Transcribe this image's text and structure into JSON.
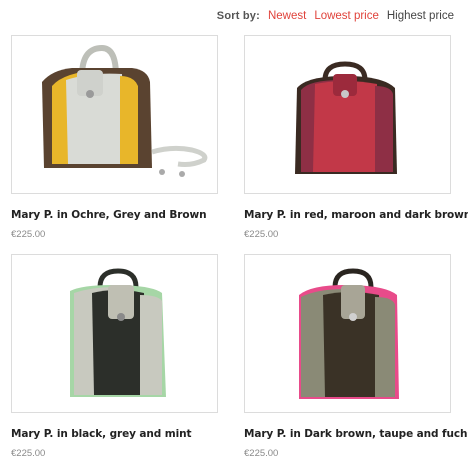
{
  "sort": {
    "label": "Sort by:",
    "options": [
      "Newest",
      "Lowest price",
      "Highest price"
    ]
  },
  "products": [
    {
      "title": "Mary P. in Ochre, Grey and Brown",
      "price": "€225.00"
    },
    {
      "title": "Mary P. in red, maroon and dark brown",
      "price": "€225.00"
    },
    {
      "title": "Mary P. in black, grey and mint",
      "price": "€225.00"
    },
    {
      "title": "Mary P. in Dark brown, taupe and fuchsia",
      "price": "€225.00"
    }
  ],
  "colors": {
    "accent": "#e0433b",
    "ochre": "#e8b62a",
    "grey": "#d9dbd6",
    "red": "#c23848",
    "maroon": "#8e2f45",
    "black": "#2c2f2a",
    "mint": "#a6d6a6",
    "taupe": "#8a8a76",
    "fuchsia": "#e84b8a"
  }
}
